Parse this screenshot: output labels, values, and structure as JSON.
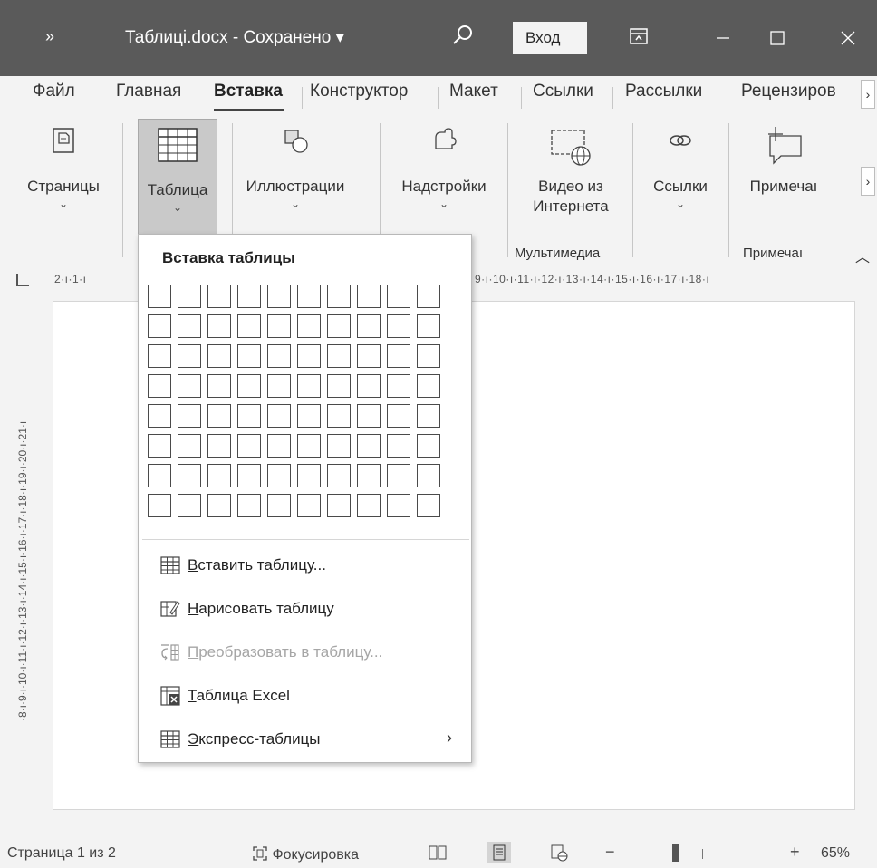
{
  "titlebar": {
    "more": "»",
    "title": "Таблиці.docx - Сохранено ▾",
    "signin": "Вход"
  },
  "tabs": [
    {
      "label": "Файл"
    },
    {
      "label": "Главная"
    },
    {
      "label": "Вставка"
    },
    {
      "label": "Конструктор"
    },
    {
      "label": "Макет"
    },
    {
      "label": "Ссылки"
    },
    {
      "label": "Рассылки"
    },
    {
      "label": "Рецензиров"
    }
  ],
  "ribbon": {
    "pages": "Страницы",
    "table": "Таблица",
    "illustrations": "Иллюстрации",
    "addins": "Надстройки",
    "video_l1": "Видео из",
    "video_l2": "Интернета",
    "links": "Ссылки",
    "comments": "Примечаı",
    "group_media": "Мультимедиа",
    "group_comments": "Примечаı"
  },
  "ruler": {
    "left": "2·ı·1·ı",
    "right": "9·ı·10·ı·11·ı·12·ı·13·ı·14·ı·15·ı·16·ı·17·ı·18·ı",
    "vertical": "·8·ı·9·ı·10·ı·11·ı·12·ı·13·ı·14·ı·15·ı·16·ı·17·ı·18·ı·19·ı·20·ı·21·ı"
  },
  "dropdown": {
    "header": "Вставка таблицы",
    "grid": {
      "cols": 10,
      "rows": 8
    },
    "items": [
      {
        "u": "В",
        "rest": "ставить таблицу...",
        "icon": "insert-table-icon",
        "disabled": false
      },
      {
        "u": "Н",
        "rest": "арисовать таблицу",
        "icon": "draw-table-icon",
        "disabled": false
      },
      {
        "u": "П",
        "rest": "реобразовать в таблицу...",
        "icon": "convert-to-table-icon",
        "disabled": true
      },
      {
        "u": "Т",
        "rest": "аблица Excel",
        "icon": "excel-table-icon",
        "disabled": false
      },
      {
        "u": "Э",
        "rest": "кспресс-таблицы",
        "icon": "quick-tables-icon",
        "disabled": false,
        "submenu": true
      }
    ]
  },
  "statusbar": {
    "page": "Страница 1 из 2",
    "focus": "Фокусировка",
    "zoom_minus": "−",
    "zoom_plus": "+",
    "zoom": "65%",
    "zoom_value": 65
  }
}
